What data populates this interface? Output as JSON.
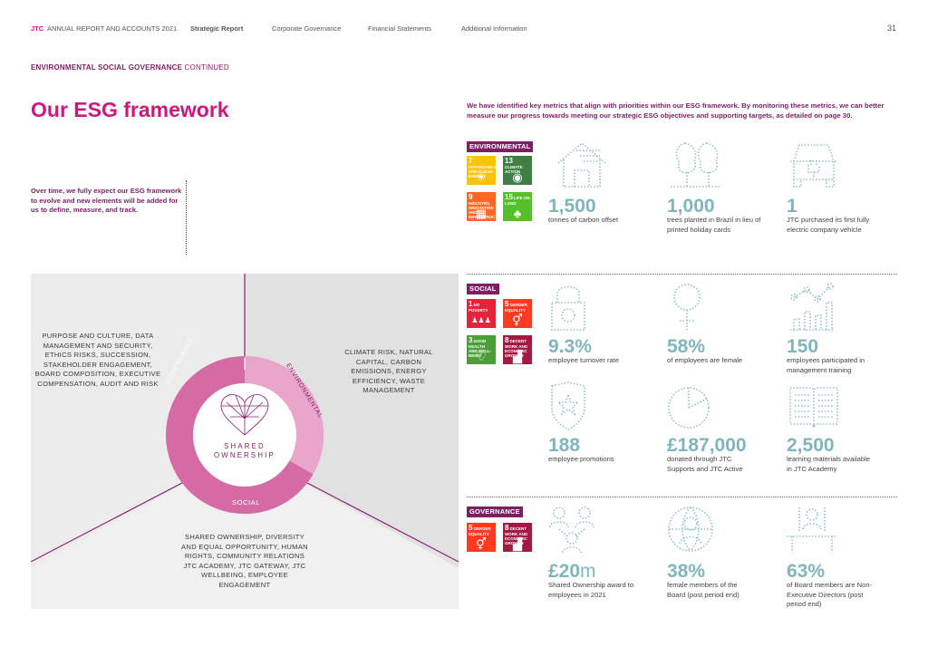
{
  "header": {
    "brand": "JTC",
    "report": "ANNUAL REPORT AND ACCOUNTS 2021",
    "nav": [
      "Strategic Report",
      "Corporate Governance",
      "Financial Statements",
      "Additional Information"
    ],
    "active_nav": "Strategic Report",
    "page_number": "31"
  },
  "section": {
    "strong": "ENVIRONMENTAL SOCIAL GOVERNANCE",
    "rest": "CONTINUED"
  },
  "title": "Our ESG framework",
  "intro_left": "Over time, we fully expect our ESG framework to evolve and new elements will be added for us to define, measure, and track.",
  "intro_right": "We have identified key metrics that align with priorities within our ESG framework. By monitoring these metrics, we can better measure our progress towards meeting our strategic ESG objectives and supporting targets, as detailed on page 30.",
  "diagram": {
    "governance_text": "PURPOSE AND CULTURE, DATA MANAGEMENT AND SECURITY, ETHICS RISKS, SUCCESSION, STAKEHOLDER ENGAGEMENT, BOARD COMPOSITION, EXECUTIVE COMPENSATION, AUDIT AND RISK",
    "environmental_text": "CLIMATE RISK, NATURAL CAPITAL, CARBON EMISSIONS, ENERGY EFFICIENCY, WASTE MANAGEMENT",
    "social_text": "SHARED OWNERSHIP, DIVERSITY AND EQUAL OPPORTUNITY, HUMAN RIGHTS, COMMUNITY RELATIONS JTC ACADEMY, JTC GATEWAY, JTC WELLBEING, EMPLOYEE ENGAGEMENT",
    "ring_governance": "GOVERNANCE",
    "ring_environmental": "ENVIRONMENTAL",
    "ring_social": "SOCIAL",
    "center_line1": "SHARED",
    "center_line2": "OWNERSHIP"
  },
  "environmental": {
    "label": "ENVIRONMENTAL",
    "sdgs": [
      {
        "num": "7",
        "text": "AFFORDABLE AND CLEAN ENERGY",
        "color": "#fcc30b",
        "glyph": "☀"
      },
      {
        "num": "13",
        "text": "CLIMATE ACTION",
        "color": "#3f7e44",
        "glyph": "◉"
      },
      {
        "num": "9",
        "text": "INDUSTRY, INNOVATION AND INFRASTRUCTURE",
        "color": "#fd6925",
        "glyph": "▦"
      },
      {
        "num": "15",
        "text": "LIFE ON LAND",
        "color": "#56c02b",
        "glyph": "♣"
      }
    ],
    "metrics": [
      {
        "value": "1,500",
        "desc": "tonnes of carbon offset",
        "icon": "house-icon"
      },
      {
        "value": "1,000",
        "desc": "trees planted in Brazil in lieu of printed holiday cards",
        "icon": "trees-icon"
      },
      {
        "value": "1",
        "desc": "JTC purchased its first fully electric company vehicle",
        "icon": "electric-car-icon"
      }
    ]
  },
  "social": {
    "label": "SOCIAL",
    "sdgs": [
      {
        "num": "1",
        "text": "NO POVERTY",
        "color": "#e5243b",
        "glyph": "♟♟♟"
      },
      {
        "num": "5",
        "text": "GENDER EQUALITY",
        "color": "#ff3a21",
        "glyph": "⚥"
      },
      {
        "num": "3",
        "text": "GOOD HEALTH AND WELL-BEING",
        "color": "#4c9f38",
        "glyph": "♡"
      },
      {
        "num": "8",
        "text": "DECENT WORK AND ECONOMIC GROWTH",
        "color": "#a21942",
        "glyph": "▟"
      }
    ],
    "metrics": [
      {
        "value": "9.3%",
        "desc": "employee turnover rate",
        "icon": "padlock-icon"
      },
      {
        "value": "58%",
        "desc": "of employees are female",
        "icon": "female-symbol-icon"
      },
      {
        "value": "150",
        "desc": "employees participated in management training",
        "icon": "growth-chart-icon"
      },
      {
        "value": "188",
        "desc": "employee promotions",
        "icon": "badge-star-icon"
      },
      {
        "value": "£187,000",
        "desc": "donated through JTC Supports and JTC Active",
        "icon": "pie-chart-icon"
      },
      {
        "value": "2,500",
        "desc": "learning materials available in JTC Academy",
        "icon": "open-book-icon"
      }
    ]
  },
  "governance": {
    "label": "GOVERNANCE",
    "sdgs": [
      {
        "num": "5",
        "text": "GENDER EQUALITY",
        "color": "#ff3a21",
        "glyph": "⚥"
      },
      {
        "num": "8",
        "text": "DECENT WORK AND ECONOMIC GROWTH",
        "color": "#a21942",
        "glyph": "▟"
      }
    ],
    "metrics": [
      {
        "value": "£20",
        "unit": "m",
        "desc": "Shared Ownership award to employees in 2021",
        "icon": "people-network-icon"
      },
      {
        "value": "38%",
        "desc": "female members of the Board (post period end)",
        "icon": "female-globe-icon"
      },
      {
        "value": "63%",
        "desc": "of Board members are Non-Executive Directors (post period end)",
        "icon": "boardroom-icon"
      }
    ]
  },
  "colors": {
    "magenta": "#d2157d",
    "teal": "#7fb6bd",
    "plum": "#7e1e63",
    "ring_dark": "#d56aa4",
    "ring_light": "#eaa5cb"
  }
}
